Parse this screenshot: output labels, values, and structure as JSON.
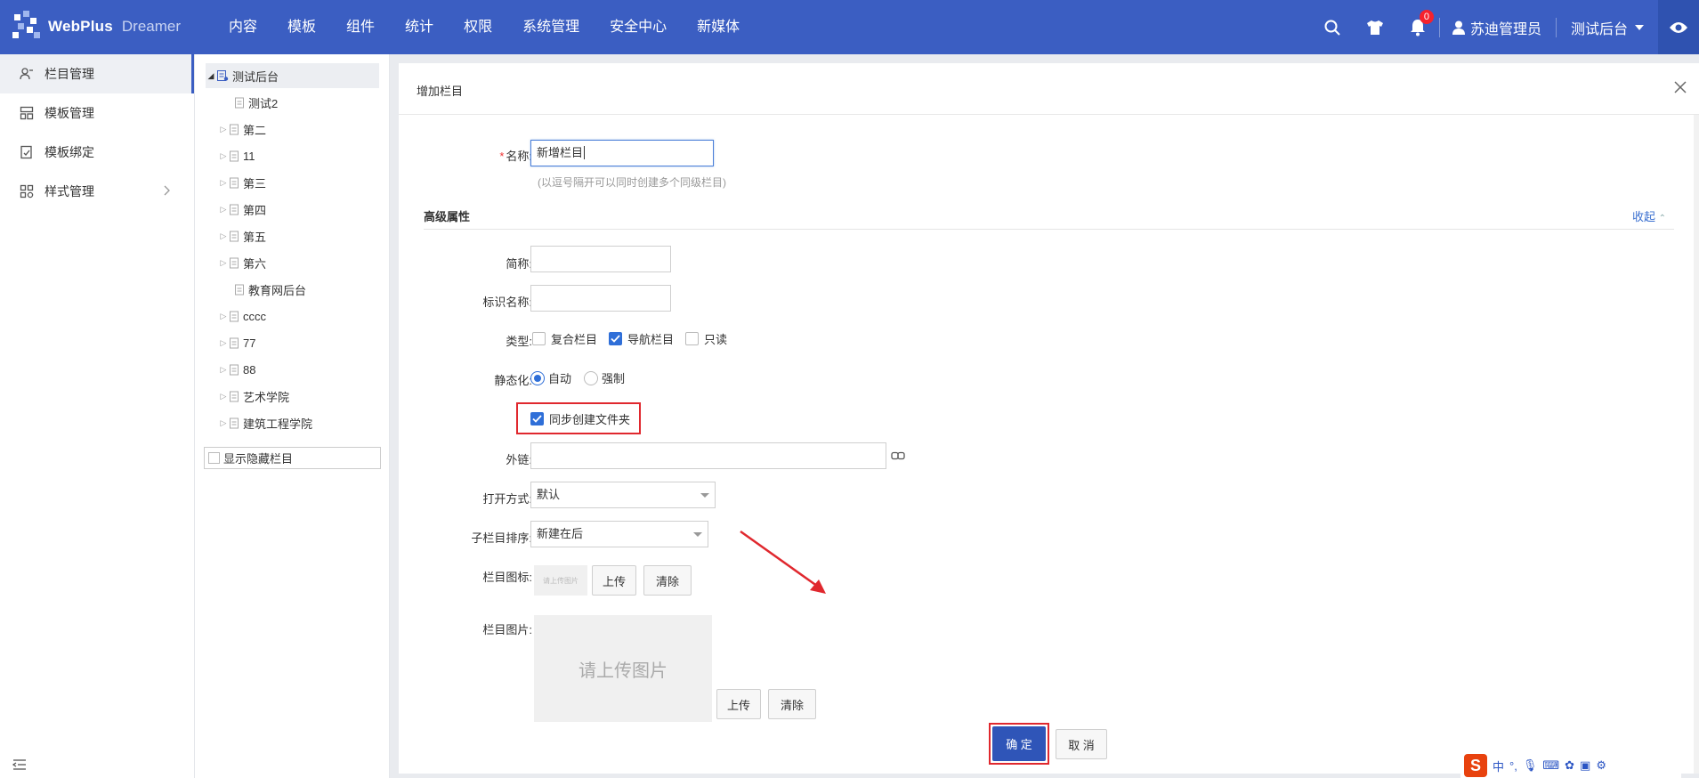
{
  "brand": {
    "name": "WebPlus",
    "sub": "Dreamer"
  },
  "topnav": [
    "内容",
    "模板",
    "组件",
    "统计",
    "权限",
    "系统管理",
    "安全中心",
    "新媒体"
  ],
  "topbar": {
    "notification_count": "0",
    "user_name": "苏迪管理员",
    "site_name": "测试后台"
  },
  "sidebar": {
    "items": [
      {
        "label": "栏目管理",
        "icon": "column-manage-icon"
      },
      {
        "label": "模板管理",
        "icon": "template-manage-icon"
      },
      {
        "label": "模板绑定",
        "icon": "template-bind-icon"
      },
      {
        "label": "样式管理",
        "icon": "style-manage-icon"
      }
    ]
  },
  "tree": {
    "root": "测试后台",
    "nodes": [
      "测试2",
      "第二",
      "11",
      "第三",
      "第四",
      "第五",
      "第六",
      "教育网后台",
      "cccc",
      "77",
      "88",
      "艺术学院",
      "建筑工程学院"
    ],
    "show_hidden_label": "显示隐藏栏目"
  },
  "modal": {
    "title": "增加栏目",
    "name_label": "名称:",
    "name_value": "新增栏目",
    "name_hint": "(以逗号隔开可以同时创建多个同级栏目)",
    "advanced_title": "高级属性",
    "collapse_label": "收起",
    "short_label": "简称:",
    "ident_label": "标识名称:",
    "type_label": "类型:",
    "type_options": [
      "复合栏目",
      "导航栏目",
      "只读"
    ],
    "static_label": "静态化:",
    "static_options": [
      "自动",
      "强制"
    ],
    "sync_folder_label": "同步创建文件夹",
    "link_label": "外链:",
    "open_label": "打开方式:",
    "open_value": "默认",
    "sort_label": "子栏目排序:",
    "sort_value": "新建在后",
    "icon_label": "栏目图标:",
    "icon_preview_text": "请上传图片",
    "upload_label": "上传",
    "clear_label": "清除",
    "image_label": "栏目图片:",
    "image_placeholder": "请上传图片",
    "confirm_label": "确 定",
    "cancel_label": "取 消"
  },
  "ime": {
    "lang": "中",
    "punct": "°,"
  }
}
